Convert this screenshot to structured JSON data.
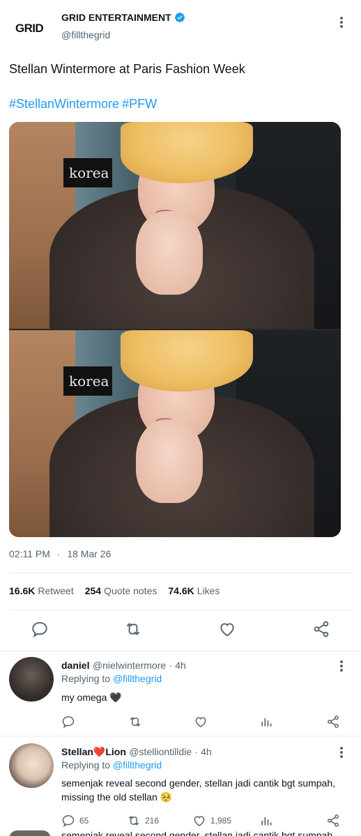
{
  "account": {
    "logo_text": "GRID",
    "name": "GRID ENTERTAINMENT",
    "handle": "@fillthegrid"
  },
  "tweet": {
    "text": "Stellan Wintermore at Paris Fashion Week",
    "hashtags": [
      "#StellanWintermore",
      "#PFW"
    ],
    "photo_sign_text": "korea",
    "time": "02:11 PM",
    "date": "18 Mar 26",
    "stats": {
      "retweets_count": "16.6K",
      "retweets_label": "Retweet",
      "quotes_count": "254",
      "quotes_label": "Quote notes",
      "likes_count": "74.6K",
      "likes_label": "Likes"
    }
  },
  "replies": [
    {
      "name": "daniel",
      "handle": "@nielwintermore",
      "time": "4h",
      "replying_prefix": "Replying to",
      "replying_to": "@fillthegrid",
      "text": "my omega 🖤"
    },
    {
      "name_part1": "Stellan",
      "name_emoji": "❤️",
      "name_part2": "Lion",
      "handle": "@stelliontilldie",
      "time": "4h",
      "replying_prefix": "Replying to",
      "replying_to": "@fillthegrid",
      "text_line1": "semenjak reveal second gender, stellan jadi cantik bgt sumpah,",
      "text_line2": "missing the old stellan 🥺",
      "replies_count": "65",
      "retweets_count": "216",
      "likes_count": "1,985"
    }
  ],
  "cutoff_text": "semenjak reveal second gender, stellan jadi cantik bgt sumpah",
  "colors": {
    "accent": "#1d9bf0",
    "muted": "#536471",
    "text": "#0f1419"
  }
}
